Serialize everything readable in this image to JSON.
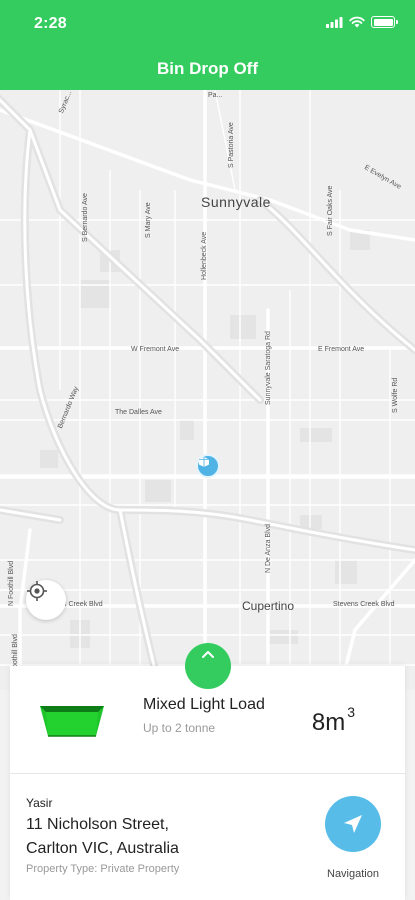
{
  "status_bar": {
    "time": "2:28"
  },
  "header": {
    "title": "Bin Drop Off"
  },
  "map": {
    "labels": {
      "sunnyvale": "Sunnyvale",
      "cupertino": "Cupertino",
      "w_fremont": "W Fremont Ave",
      "e_fremont": "E Fremont Ave",
      "dalles": "The Dalles Ave",
      "stevens_creek_right": "Stevens Creek Blvd",
      "stevens_creek_left": "s Creek Blvd",
      "sunnyvale_saratoga": "Sunnyvale Saratoga Rd",
      "hollenbeck": "Hollenbeck Ave",
      "s_mary": "S Mary Ave",
      "s_bernardo": "S Bernardo Ave",
      "s_pastoria": "S Pastoria Ave",
      "s_fair_oaks": "S Fair Oaks Ave",
      "e_evelyn": "E Evelyn Ave",
      "s_wolfe": "S Wolfe Rd",
      "n_de_anza": "N De Anza Blvd",
      "n_foothill": "N Foothill Blvd",
      "foothill_blvd": "oothill Blvd",
      "bernardo_way": "Bernardo Way",
      "pastoria_top": "Pa...",
      "syracuse": "Syrac..."
    }
  },
  "bin": {
    "title": "Mixed Light Load",
    "subtitle": "Up to 2 tonne",
    "size_value": "8m",
    "size_exp": "3",
    "color": "#1fc42b"
  },
  "address": {
    "name": "Yasir",
    "line1": "11 Nicholson Street,",
    "line2": "Carlton VIC, Australia",
    "property_type": "Property Type: Private Property"
  },
  "navigation": {
    "label": "Navigation"
  },
  "colors": {
    "brand": "#34cc5f",
    "nav": "#57bde8"
  }
}
